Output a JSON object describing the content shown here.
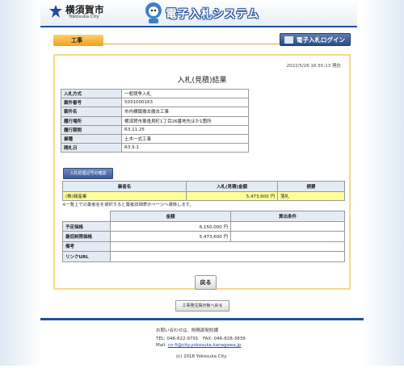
{
  "header": {
    "city_name": "横須賀市",
    "city_sub": "Yokosuka City",
    "app_title": "電子入札システム"
  },
  "nav": {
    "tab_label": "工事",
    "login_label": "電子入札ログイン"
  },
  "panel": {
    "timestamp": "2022/5/26 16:55:13 現在",
    "title": "入札(見積)結果",
    "info_rows": [
      {
        "label": "入札方式",
        "value": "一般競争入札"
      },
      {
        "label": "案件番号",
        "value": "5031000163"
      },
      {
        "label": "案件名",
        "value": "市内標識撤去撤去工事"
      },
      {
        "label": "履行場所",
        "value": "横須賀市東逸見町1丁目26番地先ほか1箇所"
      },
      {
        "label": "履行期間",
        "value": "R3.11.25"
      },
      {
        "label": "業種",
        "value": "土木一式工事"
      },
      {
        "label": "開札日",
        "value": "R3.9.1"
      }
    ],
    "history_button": "入札処理記号の確認",
    "bid_headers": {
      "company": "業者名",
      "amount": "入札(見積)金額",
      "summary": "摘要"
    },
    "bid_row": {
      "company": "(株)緑産業",
      "amount": "5,473,600 円",
      "summary": "落札"
    },
    "note": "※一覧上での業者名を選択すると業者詳細表示ページへ遷移します。",
    "price_headers": {
      "amount": "金額",
      "condition": "算出条件"
    },
    "price_rows": [
      {
        "label": "予定価格",
        "amount": "6,150,000 円",
        "condition": ""
      },
      {
        "label": "最低制限価格",
        "amount": "5,473,600 円",
        "condition": ""
      },
      {
        "label": "備考",
        "amount": "",
        "condition": ""
      },
      {
        "label": "リンクURL",
        "amount": "",
        "condition": ""
      }
    ],
    "back_button": "戻る"
  },
  "bulletin_button": "工事発注掲示板へ戻る",
  "footer": {
    "contact": "お問い合わせは、財務部契約課",
    "phone": "TEL: 046-822-9791　FAX: 046-828-3839",
    "mail_prefix": "Mail: ",
    "mail": "co-fi@city.yokosuka.kanagawa.jp",
    "copyright": "(c) 2018 Yokosuka City"
  },
  "colors": {
    "brand_blue": "#1f4f9a",
    "tab_orange": "#f2a020",
    "highlight_yellow": "#ffff99"
  }
}
